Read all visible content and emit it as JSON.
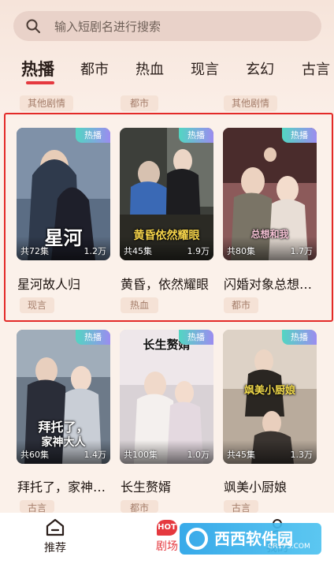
{
  "search": {
    "placeholder": "输入短剧名进行搜索"
  },
  "tabs": [
    {
      "label": "热播"
    },
    {
      "label": "都市"
    },
    {
      "label": "热血"
    },
    {
      "label": "现言"
    },
    {
      "label": "玄幻"
    },
    {
      "label": "古言"
    }
  ],
  "top_row_tags": [
    "其他剧情",
    "都市",
    "其他剧情"
  ],
  "cards": [
    {
      "badge": "热播",
      "art_title": "星河",
      "art_sub": "故人归",
      "episodes": "共72集",
      "views": "1.2万",
      "name": "星河故人归",
      "tag": "现言"
    },
    {
      "badge": "热播",
      "art_title": "黄昏依然耀眼",
      "art_sub": "",
      "episodes": "共45集",
      "views": "1.9万",
      "name": "黄昏，依然耀眼",
      "tag": "热血"
    },
    {
      "badge": "热播",
      "art_title": "总想和我",
      "art_sub": "闪婚对象",
      "episodes": "共80集",
      "views": "1.7万",
      "name": "闪婚对象总想和我拜把子",
      "tag": "都市"
    },
    {
      "badge": "热播",
      "art_title": "拜托了，",
      "art_sub": "家神大人",
      "episodes": "共60集",
      "views": "1.4万",
      "name": "拜托了，家神大人",
      "tag": "古言"
    },
    {
      "badge": "热播",
      "art_title": "长生赘婿",
      "art_sub": "",
      "episodes": "共100集",
      "views": "1.0万",
      "name": "长生赘婿",
      "tag": "都市"
    },
    {
      "badge": "热播",
      "art_title": "飒美小厨娘",
      "art_sub": "",
      "episodes": "共45集",
      "views": "1.3万",
      "name": "飒美小厨娘",
      "tag": "古言"
    }
  ],
  "nav": {
    "home": "推荐",
    "theater": "剧场",
    "theater_badge": "HOT",
    "mine": "我的"
  },
  "watermark": {
    "text": "西西软件园",
    "sub": "CR173.COM"
  },
  "colors": {
    "accent": "#e5393f",
    "background": "#fbf1ea",
    "badge_start": "#52d6c2",
    "badge_end": "#9b8cf0"
  }
}
